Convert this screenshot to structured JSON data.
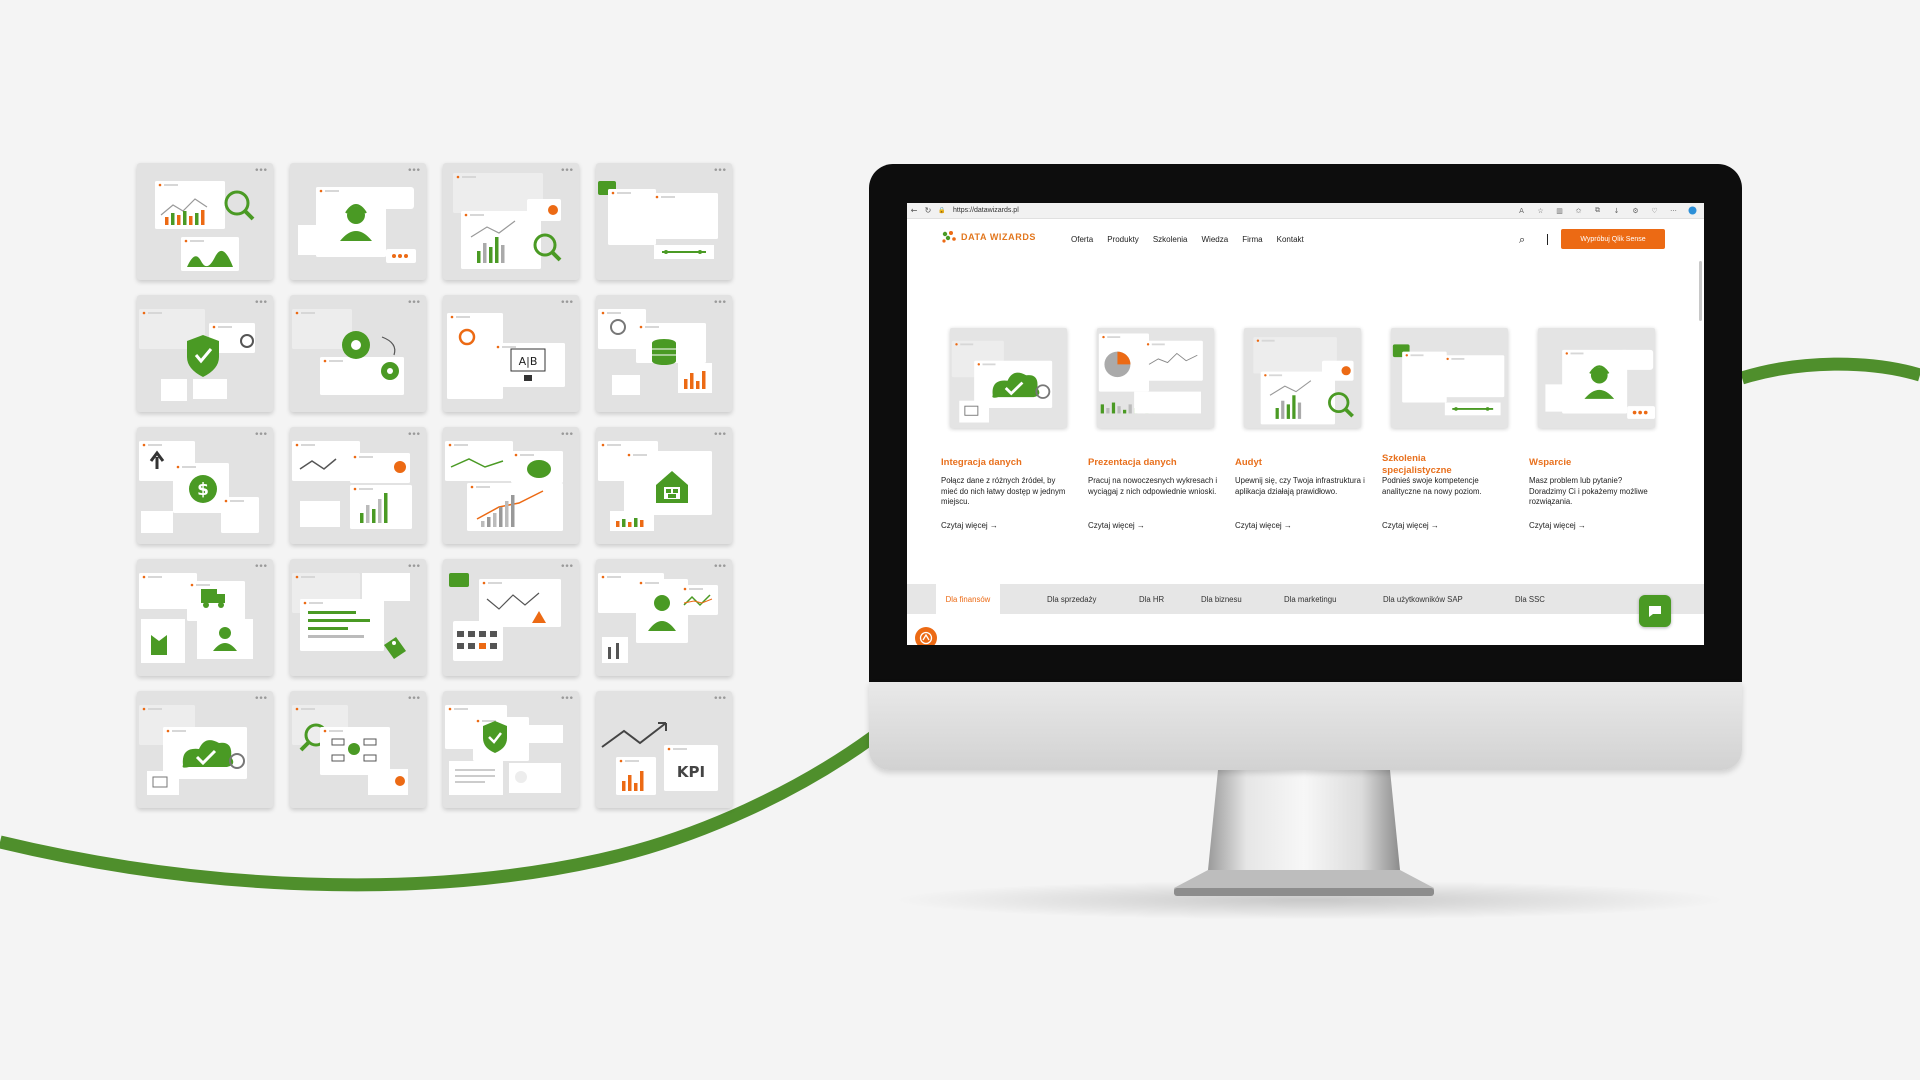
{
  "colors": {
    "accent_orange": "#ec6a14",
    "accent_green": "#4a9a24",
    "background": "#f4f4f4",
    "tile_gray": "#e2e2e2"
  },
  "tiles": [
    {
      "icon": "chart-magnifier-icon"
    },
    {
      "icon": "support-agent-icon"
    },
    {
      "icon": "bar-chart-magnifier-icon"
    },
    {
      "icon": "chat-window-icon"
    },
    {
      "icon": "shield-check-icon"
    },
    {
      "icon": "gears-icon"
    },
    {
      "icon": "ab-test-icon"
    },
    {
      "icon": "database-icon"
    },
    {
      "icon": "dollar-transfer-icon"
    },
    {
      "icon": "line-bar-chart-icon"
    },
    {
      "icon": "piggy-bank-chart-icon"
    },
    {
      "icon": "warehouse-icon"
    },
    {
      "icon": "delivery-truck-factory-icon"
    },
    {
      "icon": "list-tag-icon"
    },
    {
      "icon": "calendar-alert-icon"
    },
    {
      "icon": "user-chart-icon"
    },
    {
      "icon": "cloud-check-icon"
    },
    {
      "icon": "process-magnifier-icon"
    },
    {
      "icon": "shield-document-icon"
    },
    {
      "icon": "kpi-chart-icon"
    }
  ],
  "kpi_label": "KPI",
  "ab_label": "A|B",
  "browser": {
    "url": "https://datawizards.pl"
  },
  "site": {
    "logo_text": "DATA WIZARDS",
    "nav": [
      "Oferta",
      "Produkty",
      "Szkolenia",
      "Wiedza",
      "Firma",
      "Kontakt"
    ],
    "cta": "Wypróbuj Qlik Sense"
  },
  "cards": [
    {
      "title": "Integracja danych",
      "desc": "Połącz dane z różnych źródeł, by mieć do nich łatwy dostęp w jednym miejscu.",
      "more": "Czytaj więcej →",
      "icon": "cloud-check-icon"
    },
    {
      "title": "Prezentacja danych",
      "desc": "Pracuj na nowoczesnych wykresach i wyciągaj z nich odpowiednie wnioski.",
      "more": "Czytaj więcej →",
      "icon": "pie-chart-icon"
    },
    {
      "title": "Audyt",
      "desc": "Upewnij się, czy Twoja infrastruktura i aplikacja działają prawidłowo.",
      "more": "Czytaj więcej →",
      "icon": "bar-chart-magnifier-icon"
    },
    {
      "title": "Szkolenia specjalistyczne",
      "desc": "Podnieś swoje kompetencje analityczne na nowy poziom.",
      "more": "Czytaj więcej →",
      "icon": "chat-window-icon"
    },
    {
      "title": "Wsparcie",
      "desc": "Masz problem lub pytanie? Doradzimy Ci i pokażemy możliwe rozwiązania.",
      "more": "Czytaj więcej →",
      "icon": "support-agent-icon"
    }
  ],
  "tabs": [
    "Dla finansów",
    "Dla sprzedaży",
    "Dla HR",
    "Dla biznesu",
    "Dla marketingu",
    "Dla użytkowników SAP",
    "Dla SSC"
  ]
}
